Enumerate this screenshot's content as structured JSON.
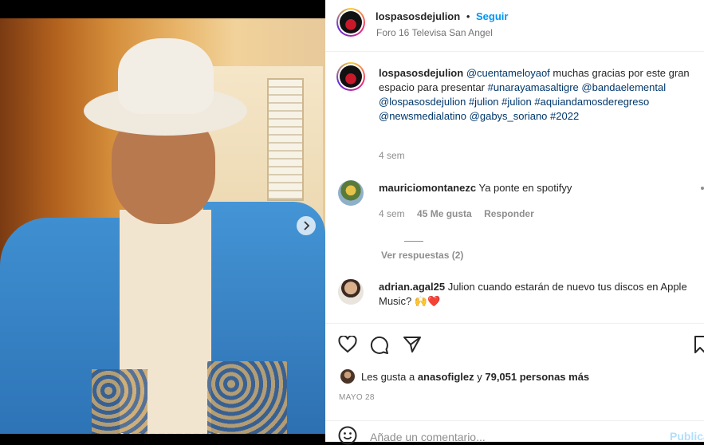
{
  "post": {
    "username": "lospasosdejulion",
    "follow_label": "Seguir",
    "separator": "•",
    "location": "Foro 16 Televisa San Angel"
  },
  "caption": {
    "username": "lospasosdejulion",
    "parts": [
      {
        "text": "@cuentameloyaof",
        "kind": "link"
      },
      {
        "text": " muchas gracias por este gran espacio para presentar ",
        "kind": "text"
      },
      {
        "text": "#unarayamasaltigre",
        "kind": "link"
      },
      {
        "text": " ",
        "kind": "text"
      },
      {
        "text": "@bandaelemental",
        "kind": "link"
      },
      {
        "text": " ",
        "kind": "text"
      },
      {
        "text": "@lospasosdejulion",
        "kind": "link"
      },
      {
        "text": " ",
        "kind": "text"
      },
      {
        "text": "#julion",
        "kind": "link"
      },
      {
        "text": " ",
        "kind": "text"
      },
      {
        "text": "#julion",
        "kind": "link"
      },
      {
        "text": " ",
        "kind": "text"
      },
      {
        "text": "#aquiandamosderegreso",
        "kind": "link"
      },
      {
        "text": " ",
        "kind": "text"
      },
      {
        "text": "@newsmedialatino",
        "kind": "link"
      },
      {
        "text": " ",
        "kind": "text"
      },
      {
        "text": "@gabys_soriano",
        "kind": "link"
      },
      {
        "text": " ",
        "kind": "text"
      },
      {
        "text": "#2022",
        "kind": "link"
      }
    ],
    "time": "4 sem"
  },
  "comments": [
    {
      "username": "mauriciomontanezc",
      "text": "Ya ponte en spotifyy",
      "time": "4 sem",
      "likes": "45 Me gusta",
      "reply_label": "Responder",
      "view_replies": "Ver respuestas (2)"
    },
    {
      "username": "adrian.agal25",
      "text": "Julion cuando estarán de nuevo tus discos en Apple Music? 🙌❤️"
    }
  ],
  "likes": {
    "prefix": "Les gusta a ",
    "user": "anasofiglez",
    "middle": " y ",
    "count": "79,051 personas más"
  },
  "date": "MAYO 28",
  "add_comment": {
    "placeholder": "Añade un comentario...",
    "publish_label": "Publicar"
  },
  "icons": {
    "next": "chevron-right-icon",
    "like": "heart-icon",
    "comment": "comment-bubble-icon",
    "share": "paper-plane-icon",
    "save": "bookmark-icon",
    "emoji": "emoji-icon"
  },
  "colors": {
    "accent": "#0095f6",
    "link": "#00376b",
    "muted": "#8e8e8e",
    "text": "#262626"
  }
}
